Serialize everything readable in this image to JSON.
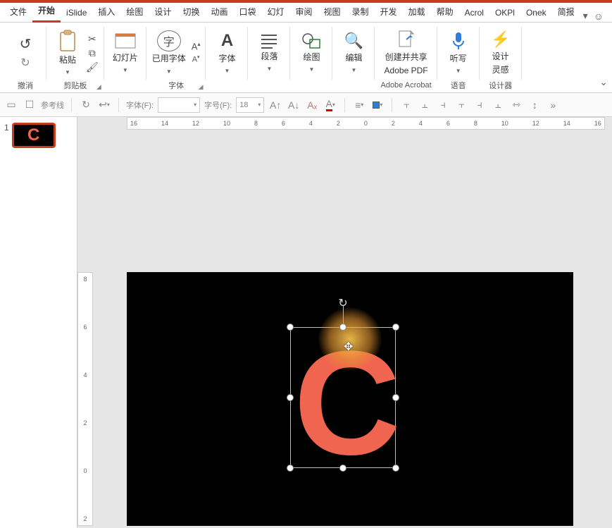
{
  "menu": {
    "tabs": [
      "文件",
      "开始",
      "iSlide",
      "插入",
      "绘图",
      "设计",
      "切换",
      "动画",
      "口袋",
      "幻灯",
      "审阅",
      "视图",
      "录制",
      "开发",
      "加载",
      "帮助",
      "Acrol",
      "OKPl",
      "Onek",
      "简报"
    ],
    "active_index": 1
  },
  "ribbon": {
    "groups": {
      "undo": {
        "label": "撤消"
      },
      "clipboard": {
        "label": "剪贴板",
        "paste": "粘贴"
      },
      "slides": {
        "label": "",
        "btn": "幻灯片"
      },
      "usedfont": {
        "btn": "已用字体"
      },
      "font": {
        "label": "字体",
        "btn": "字体"
      },
      "paragraph": {
        "label": "",
        "btn": "段落"
      },
      "drawing": {
        "label": "",
        "btn": "绘图"
      },
      "editing": {
        "label": "",
        "btn": "编辑"
      },
      "adobe": {
        "label": "Adobe Acrobat",
        "btn1": "创建并共享",
        "btn2": "Adobe PDF"
      },
      "voice": {
        "label": "语音",
        "btn": "听写"
      },
      "designer": {
        "label": "设计器",
        "btn1": "设计",
        "btn2": "灵感"
      }
    }
  },
  "toolbar2": {
    "guides_label": "参考线",
    "font_label": "字体(F):",
    "size_label": "字号(F):",
    "size_value": "18"
  },
  "ruler": {
    "h": [
      "16",
      "14",
      "12",
      "10",
      "8",
      "6",
      "4",
      "2",
      "0",
      "2",
      "4",
      "6",
      "8",
      "10",
      "12",
      "14",
      "16"
    ],
    "v": [
      "8",
      "6",
      "4",
      "2",
      "0",
      "2"
    ]
  },
  "thumbnails": {
    "items": [
      {
        "num": "1",
        "letter": "C"
      }
    ]
  },
  "slide": {
    "letter": "C"
  }
}
